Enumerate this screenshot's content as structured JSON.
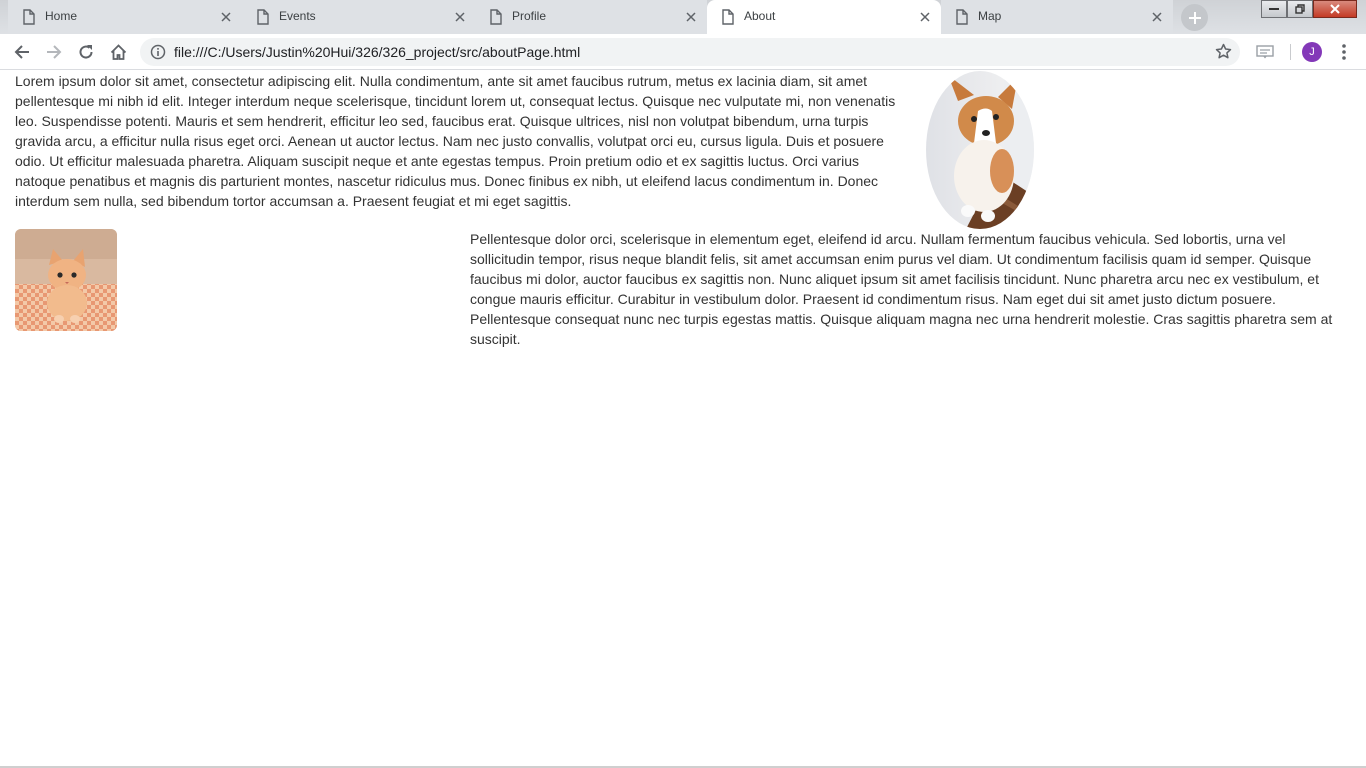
{
  "tabs": [
    {
      "title": "Home",
      "active": false
    },
    {
      "title": "Events",
      "active": false
    },
    {
      "title": "Profile",
      "active": false
    },
    {
      "title": "About",
      "active": true
    },
    {
      "title": "Map",
      "active": false
    }
  ],
  "toolbar": {
    "url": "file:///C:/Users/Justin%20Hui/326/326_project/src/aboutPage.html",
    "avatar_initial": "J"
  },
  "page": {
    "paragraph1": "Lorem ipsum dolor sit amet, consectetur adipiscing elit. Nulla condimentum, ante sit amet faucibus rutrum, metus ex lacinia diam, sit amet pellentesque mi nibh id elit. Integer interdum neque scelerisque, tincidunt lorem ut, consequat lectus. Quisque nec vulputate mi, non venenatis leo. Suspendisse potenti. Mauris et sem hendrerit, efficitur leo sed, faucibus erat. Quisque ultrices, nisl non volutpat bibendum, urna turpis gravida arcu, a efficitur nulla risus eget orci. Aenean ut auctor lectus. Nam nec justo convallis, volutpat orci eu, cursus ligula. Duis et posuere odio. Ut efficitur malesuada pharetra. Aliquam suscipit neque et ante egestas tempus. Proin pretium odio et ex sagittis luctus. Orci varius natoque penatibus et magnis dis parturient montes, nascetur ridiculus mus. Donec finibus ex nibh, ut eleifend lacus condimentum in. Donec interdum sem nulla, sed bibendum tortor accumsan a. Praesent feugiat et mi eget sagittis.",
    "paragraph2": "Pellentesque dolor orci, scelerisque in elementum eget, eleifend id arcu. Nullam fermentum faucibus vehicula. Sed lobortis, urna vel sollicitudin tempor, risus neque blandit felis, sit amet accumsan enim purus vel diam. Ut condimentum facilisis quam id semper. Quisque faucibus mi dolor, auctor faucibus ex sagittis non. Nunc aliquet ipsum sit amet facilisis tincidunt. Nunc pharetra arcu nec ex vestibulum, et congue mauris efficitur. Curabitur in vestibulum dolor. Praesent id condimentum risus. Nam eget dui sit amet justo dictum posuere. Pellentesque consequat nunc nec turpis egestas mattis. Quisque aliquam magna nec urna hendrerit molestie. Cras sagittis pharetra sem at suscipit."
  },
  "colors": {
    "tabstrip": "#dee1e5",
    "avatar": "#8338b8",
    "text": "#333333"
  }
}
